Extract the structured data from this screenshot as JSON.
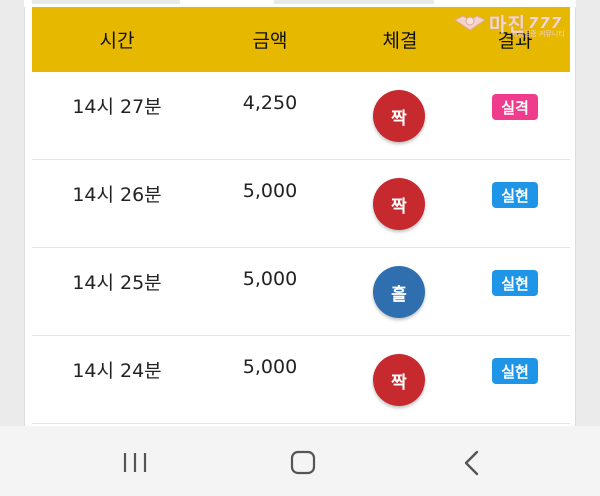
{
  "watermark": {
    "brand": "마진",
    "suffix": "777",
    "sub": "먹튀검증 커뮤니티"
  },
  "header": {
    "columns": [
      "시간",
      "금액",
      "체결",
      "결과"
    ]
  },
  "rows": [
    {
      "time": "14시 27분",
      "amount": "4,250",
      "bet": "짝",
      "result": "실격"
    },
    {
      "time": "14시 26분",
      "amount": "5,000",
      "bet": "짝",
      "result": "실현"
    },
    {
      "time": "14시 25분",
      "amount": "5,000",
      "bet": "홀",
      "result": "실현"
    },
    {
      "time": "14시 24분",
      "amount": "5,000",
      "bet": "짝",
      "result": "실현"
    }
  ],
  "colors": {
    "header_bg": "#e6b800",
    "even_red": "#c62a2e",
    "odd_blue": "#2f6fb0",
    "fail_pink": "#f03c8c",
    "success_blue": "#1f95e8"
  },
  "navbar": {
    "icons": [
      "recent-apps-icon",
      "home-icon",
      "back-icon"
    ]
  }
}
